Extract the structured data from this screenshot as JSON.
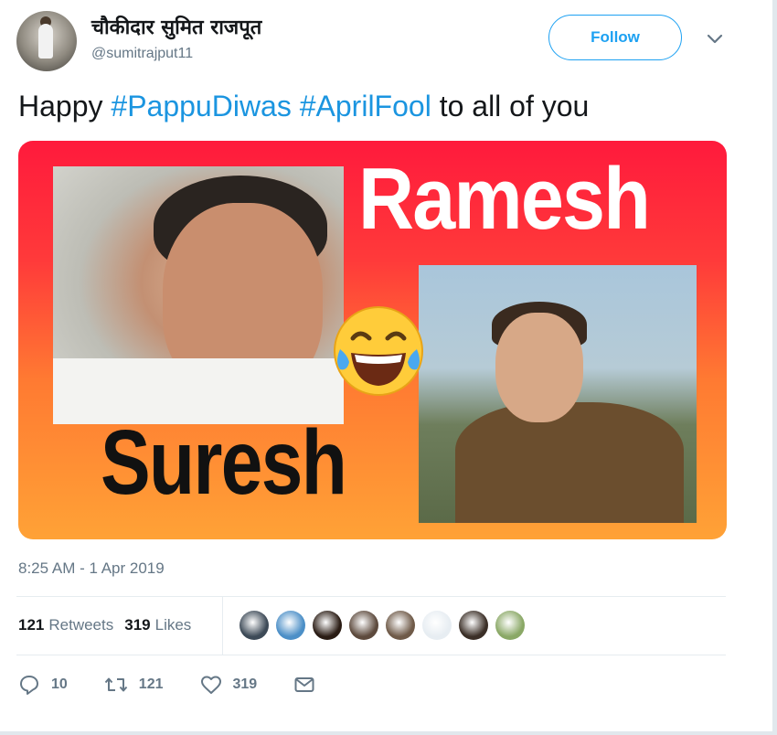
{
  "header": {
    "display_name": "चौकीदार सुमित राजपूत",
    "handle": "@sumitrajput11",
    "follow_label": "Follow"
  },
  "tweet": {
    "text_prefix": "Happy ",
    "hashtag_1": "#PappuDiwas",
    "hashtag_2": "#AprilFool",
    "text_suffix": " to all of you"
  },
  "media": {
    "top_word": "Ramesh",
    "bottom_word": "Suresh",
    "colors": {
      "gradient_top": "#ff1a3c",
      "gradient_bottom": "#ffa236"
    }
  },
  "timestamp": "8:25 AM - 1 Apr 2019",
  "stats": {
    "retweets_count": "121",
    "retweets_label": "Retweets",
    "likes_count": "319",
    "likes_label": "Likes"
  },
  "liker_avatars": [
    {
      "color": "#3d4a57"
    },
    {
      "color": "#4c8fc7"
    },
    {
      "color": "#2a1c14"
    },
    {
      "color": "#5d4a3d"
    },
    {
      "color": "#6f5a48"
    },
    {
      "color": "#e7edf2"
    },
    {
      "color": "#3b2f27"
    },
    {
      "color": "#8aa866"
    }
  ],
  "actions": {
    "reply_count": "10",
    "retweet_count": "121",
    "like_count": "319"
  },
  "icons": {
    "caret": "chevron-down-icon",
    "reply": "reply-icon",
    "retweet": "retweet-icon",
    "like": "heart-icon",
    "dm": "envelope-icon"
  },
  "accent": "#1da1f2"
}
